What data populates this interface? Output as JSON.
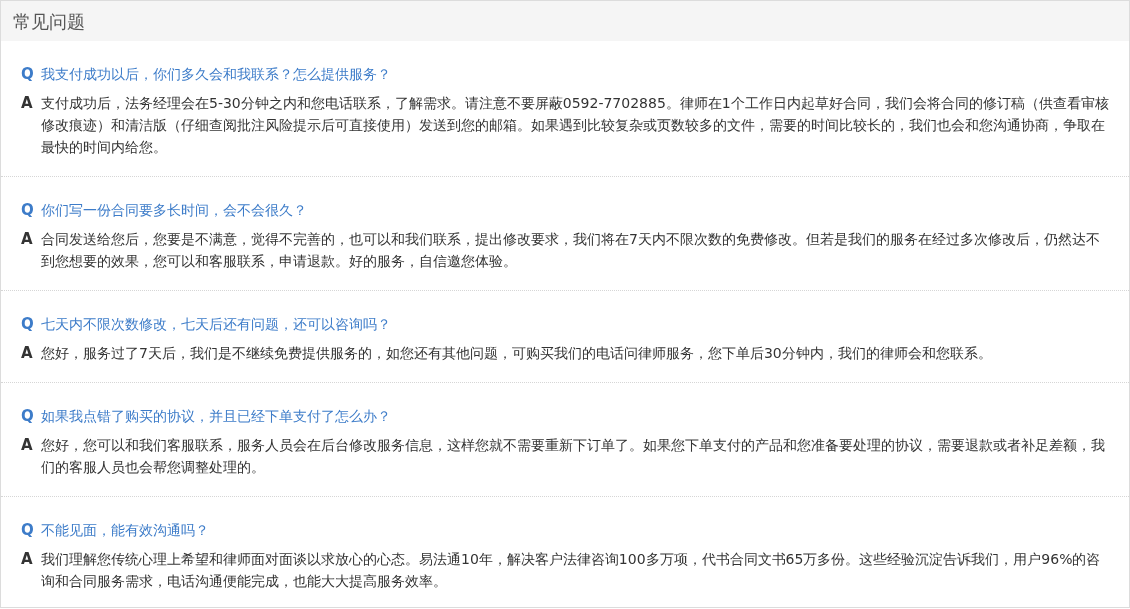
{
  "title": "常见问题",
  "faqs": [
    {
      "q_mark": "Q",
      "question": "我支付成功以后，你们多久会和我联系？怎么提供服务？",
      "a_mark": "A",
      "answer": "支付成功后，法务经理会在5-30分钟之内和您电话联系，了解需求。请注意不要屏蔽0592-7702885。律师在1个工作日内起草好合同，我们会将合同的修订稿（供查看审核修改痕迹）和清洁版（仔细查阅批注风险提示后可直接使用）发送到您的邮箱。如果遇到比较复杂或页数较多的文件，需要的时间比较长的，我们也会和您沟通协商，争取在最快的时间内给您。"
    },
    {
      "q_mark": "Q",
      "question": "你们写一份合同要多长时间，会不会很久？",
      "a_mark": "A",
      "answer": "合同发送给您后，您要是不满意，觉得不完善的，也可以和我们联系，提出修改要求，我们将在7天内不限次数的免费修改。但若是我们的服务在经过多次修改后，仍然达不到您想要的效果，您可以和客服联系，申请退款。好的服务，自信邀您体验。"
    },
    {
      "q_mark": "Q",
      "question": "七天内不限次数修改，七天后还有问题，还可以咨询吗？",
      "a_mark": "A",
      "answer": "您好，服务过了7天后，我们是不继续免费提供服务的，如您还有其他问题，可购买我们的电话问律师服务，您下单后30分钟内，我们的律师会和您联系。"
    },
    {
      "q_mark": "Q",
      "question": "如果我点错了购买的协议，并且已经下单支付了怎么办？",
      "a_mark": "A",
      "answer": "您好，您可以和我们客服联系，服务人员会在后台修改服务信息，这样您就不需要重新下订单了。如果您下单支付的产品和您准备要处理的协议，需要退款或者补足差额，我们的客服人员也会帮您调整处理的。"
    },
    {
      "q_mark": "Q",
      "question": "不能见面，能有效沟通吗？",
      "a_mark": "A",
      "answer": "我们理解您传统心理上希望和律师面对面谈以求放心的心态。易法通10年，解决客户法律咨询100多万项，代书合同文书65万多份。这些经验沉淀告诉我们，用户96%的咨询和合同服务需求，电话沟通便能完成，也能大大提高服务效率。"
    }
  ]
}
